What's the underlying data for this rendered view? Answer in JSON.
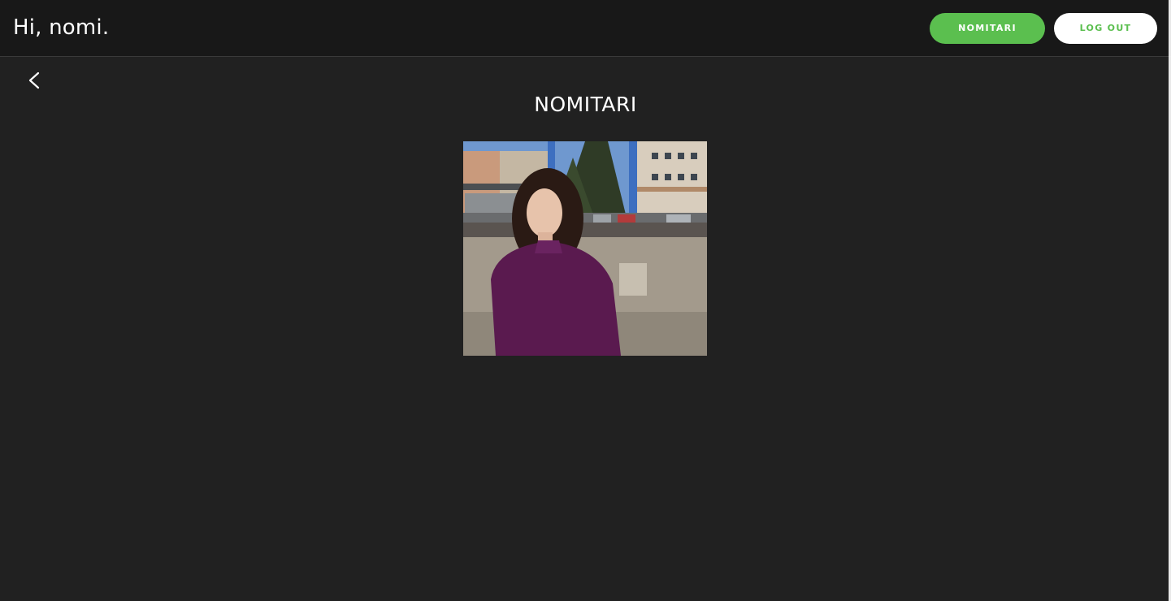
{
  "header": {
    "greeting": "Hi, nomi.",
    "profile_button_label": "NOMITARI",
    "logout_button_label": "LOG OUT"
  },
  "nav": {
    "back_icon": "chevron-left-icon"
  },
  "profile": {
    "title": "NOMITARI",
    "photo": "profile-photo"
  },
  "colors": {
    "accent": "#5bbf4f",
    "background": "#212121",
    "header_background": "#181818"
  }
}
